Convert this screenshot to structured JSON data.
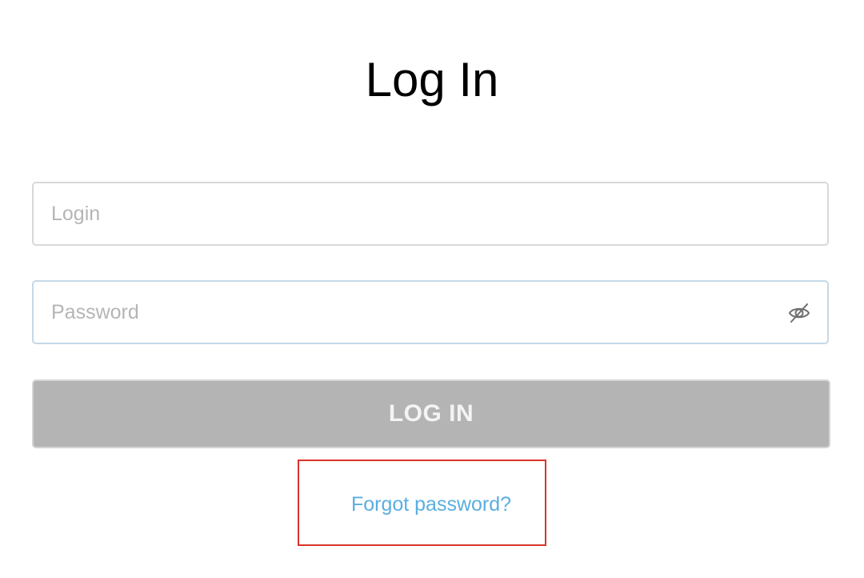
{
  "page": {
    "title": "Log In"
  },
  "form": {
    "login": {
      "placeholder": "Login",
      "value": ""
    },
    "password": {
      "placeholder": "Password",
      "value": "",
      "toggle_icon": "eye-slash-icon"
    },
    "submit_label": "LOG IN",
    "forgot_label": "Forgot password?"
  },
  "colors": {
    "title": "#000000",
    "button_bg": "#b4b4b4",
    "button_text": "#f4f4f4",
    "link": "#5aaee0",
    "highlight": "#d9342b"
  }
}
